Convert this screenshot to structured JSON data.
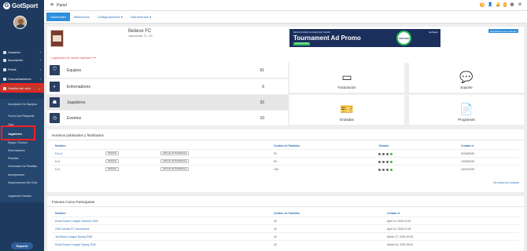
{
  "brand": {
    "logo_text": "GotSport"
  },
  "sidebar": {
    "items": [
      {
        "label": "Usuarios"
      },
      {
        "label": "Asociación"
      },
      {
        "label": "Fields"
      },
      {
        "label": "Comunicaciones"
      },
      {
        "label": "Gestión del club"
      }
    ],
    "subitems": [
      {
        "label": "Inscripción De Equipos"
      },
      {
        "label": "Forms And Requests"
      },
      {
        "label": "Club"
      },
      {
        "label": "Jugadores"
      },
      {
        "label": "Equipo Técnico"
      },
      {
        "label": "Entrenadores"
      },
      {
        "label": "Planillas"
      },
      {
        "label": "Generador De Planillas"
      },
      {
        "label": "Inscripciones"
      },
      {
        "label": "Suspensiones Del Club"
      },
      {
        "label": "Jugadores Ocultos"
      }
    ],
    "support": "Soporte"
  },
  "topbar": {
    "title": "Panel",
    "badge": "6"
  },
  "tabs": [
    {
      "label": "Dashboard"
    },
    {
      "label": "Afiliaciones"
    },
    {
      "label": "Configuraciones ▾"
    },
    {
      "label": "Instrumentos ▾"
    }
  ],
  "header": {
    "club_name": "Believe FC",
    "location": "Jacksonville, FL, US",
    "duplicates": "1 jugador(es) de usuario duplicado ⟶",
    "update_button": "Actualizaciones recientes",
    "ad": {
      "small": "REACH MORE COACHES AND TEAMS",
      "big": "Tournament Ad Promo",
      "button": "LEARN MORE",
      "badge": "SOCCER",
      "brand": "GotSport"
    }
  },
  "stats": [
    {
      "label": "Equipos",
      "value": "61",
      "icon": "shield-icon"
    },
    {
      "label": "Entrenadores",
      "value": "6",
      "icon": "whistle-icon"
    },
    {
      "label": "Jugadores",
      "value": "32",
      "icon": "group-icon"
    },
    {
      "label": "Eventos",
      "value": "10",
      "icon": "clock-icon"
    }
  ],
  "quick": [
    {
      "label": "Facturación",
      "icon": "wallet-icon"
    },
    {
      "label": "Soporte",
      "icon": "chat-icon"
    },
    {
      "label": "Entradas",
      "icon": "ticket-icon"
    },
    {
      "label": "Programas",
      "icon": "document-icon"
    }
  ],
  "schedules": {
    "title": "Horarios publicados y finalizados",
    "headers": [
      "Nombre",
      "Conteo de Partidos",
      "Estado",
      "Creado el"
    ],
    "rows": [
      {
        "name": "8 A v1",
        "btn1": "Partidos",
        "btn2": "Informe de Partidantes",
        "count": "32",
        "date": "02/06/2026"
      },
      {
        "name": "8 v1",
        "btn1": "Partidos",
        "btn2": "Informe de Partidantes",
        "count": "63",
        "date": "10/06/2025"
      },
      {
        "name": "8 v1",
        "btn1": "Partidos",
        "btn2": "Informe de Partidantes",
        "count": "106",
        "date": "10/01/2025"
      }
    ],
    "more": "Ver todos los horarios"
  },
  "fixtures": {
    "title": "Fixtures Como Participante",
    "headers": [
      "Nombre",
      "Conteo de Partidos",
      "Creado el"
    ],
    "rows": [
      {
        "name": "Duval Soccer League Summer 2026",
        "count": "16",
        "date": "April 13, 2026 10:30"
      },
      {
        "name": "2026 Jacoby FC Tournament",
        "count": "16",
        "date": "April 10, 2026 12:25"
      },
      {
        "name": "Jax Beach League Spring 2026",
        "count": "16",
        "date": "March 17, 2026 10:36"
      },
      {
        "name": "Duval Soccer League Spring 2026",
        "count": "16",
        "date": "March 04, 2026 15:04"
      }
    ]
  }
}
